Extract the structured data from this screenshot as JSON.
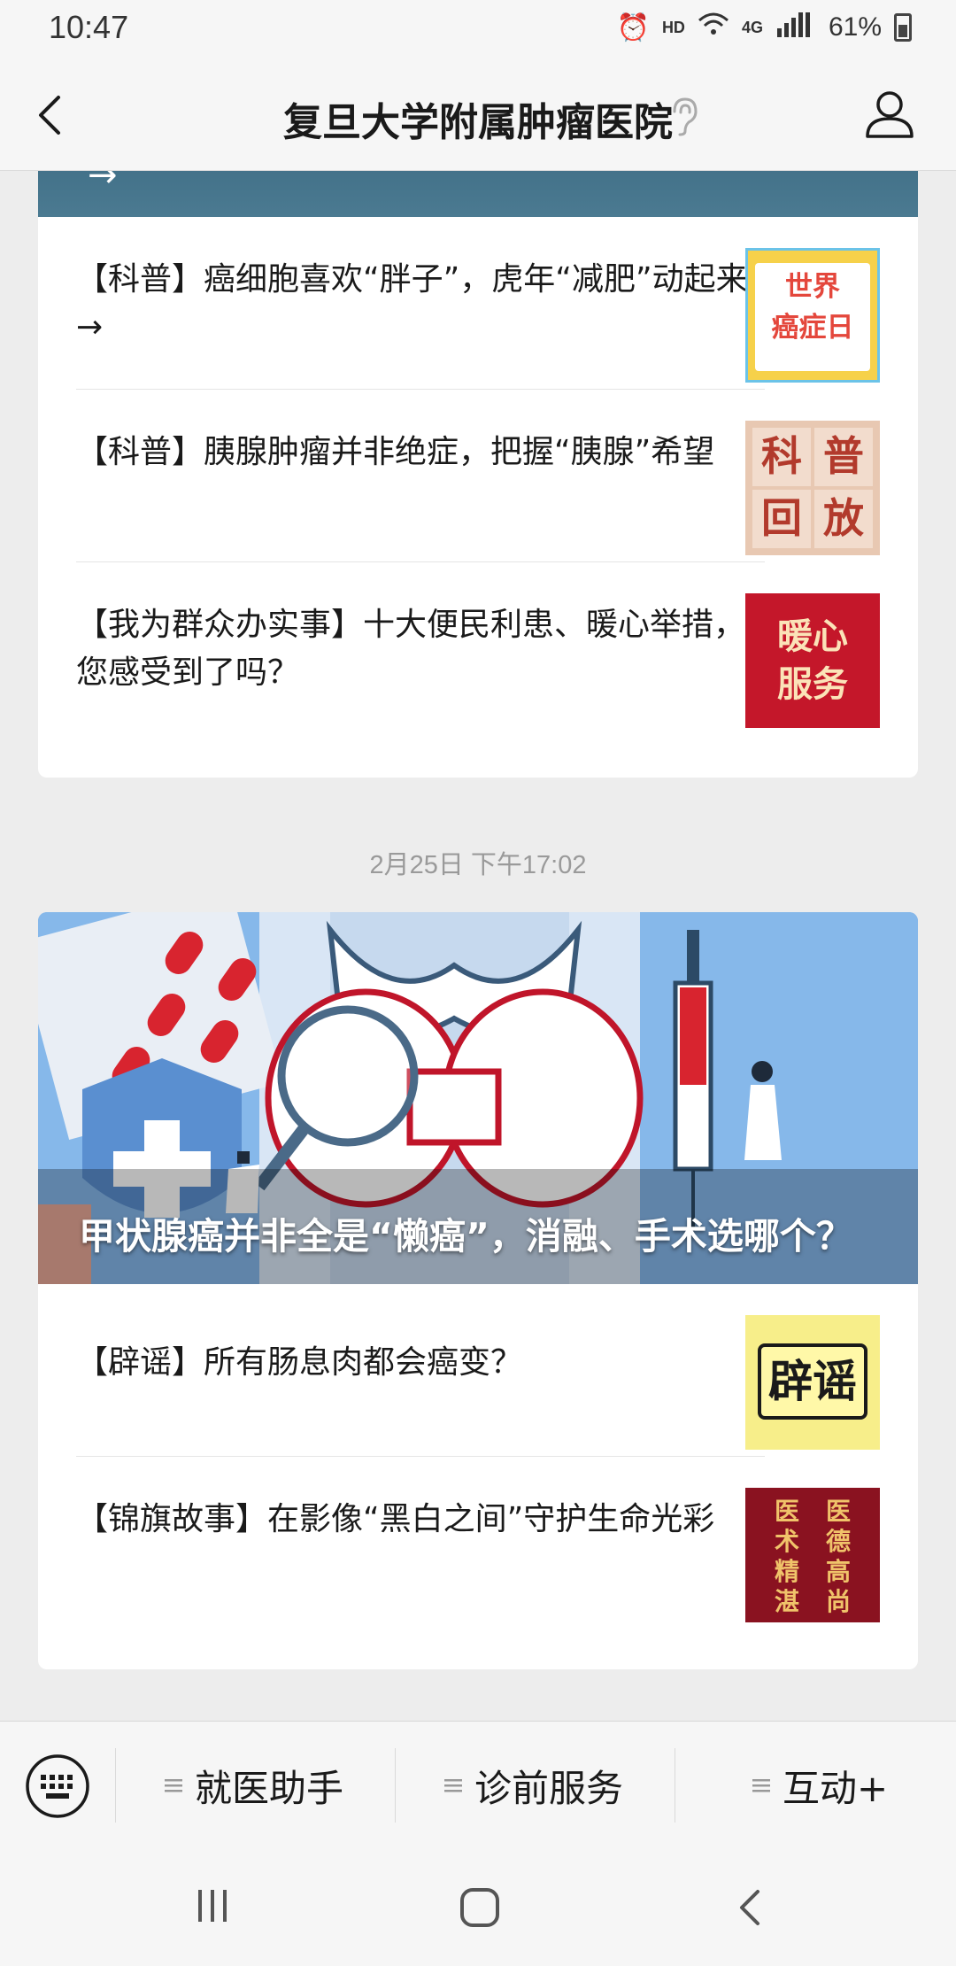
{
  "status": {
    "time": "10:47",
    "hd": "HD",
    "network": "4G",
    "battery": "61%"
  },
  "header": {
    "title": "复旦大学附属肿瘤医院"
  },
  "card1": {
    "items": [
      {
        "text": "【科普】癌细胞喜欢“胖子”，虎年“减肥”动起来→",
        "thumb": [
          "世界",
          "癌症日"
        ]
      },
      {
        "text": "【科普】胰腺肿瘤并非绝症，把握“胰腺”希望",
        "thumb": [
          "科",
          "普",
          "回",
          "放"
        ]
      },
      {
        "text": "【我为群众办实事】十大便民利患、暖心举措，您感受到了吗？",
        "thumb": [
          "暖心",
          "服务"
        ]
      }
    ]
  },
  "timestamp": "2月25日 下午17:02",
  "card2": {
    "hero_caption": "甲状腺癌并非全是“懒癌”，消融、手术选哪个？",
    "items": [
      {
        "text": "【辟谣】所有肠息肉都会癌变？",
        "thumb": [
          "辟谣"
        ]
      },
      {
        "text": "【锦旗故事】在影像“黑白之间”守护生命光彩",
        "thumb": [
          "医",
          "德",
          "高",
          "尚",
          "医",
          "术",
          "精",
          "湛"
        ]
      }
    ]
  },
  "menu": {
    "items": [
      "就医助手",
      "诊前服务",
      "互动+"
    ]
  },
  "icons": {
    "back": "chevron-left-icon",
    "ear": "ear-icon",
    "user": "user-icon",
    "keyboard": "keyboard-icon",
    "menu": "hamburger-icon",
    "nav_recent": "recent-apps-icon",
    "nav_home": "home-icon",
    "nav_back": "back-icon"
  }
}
